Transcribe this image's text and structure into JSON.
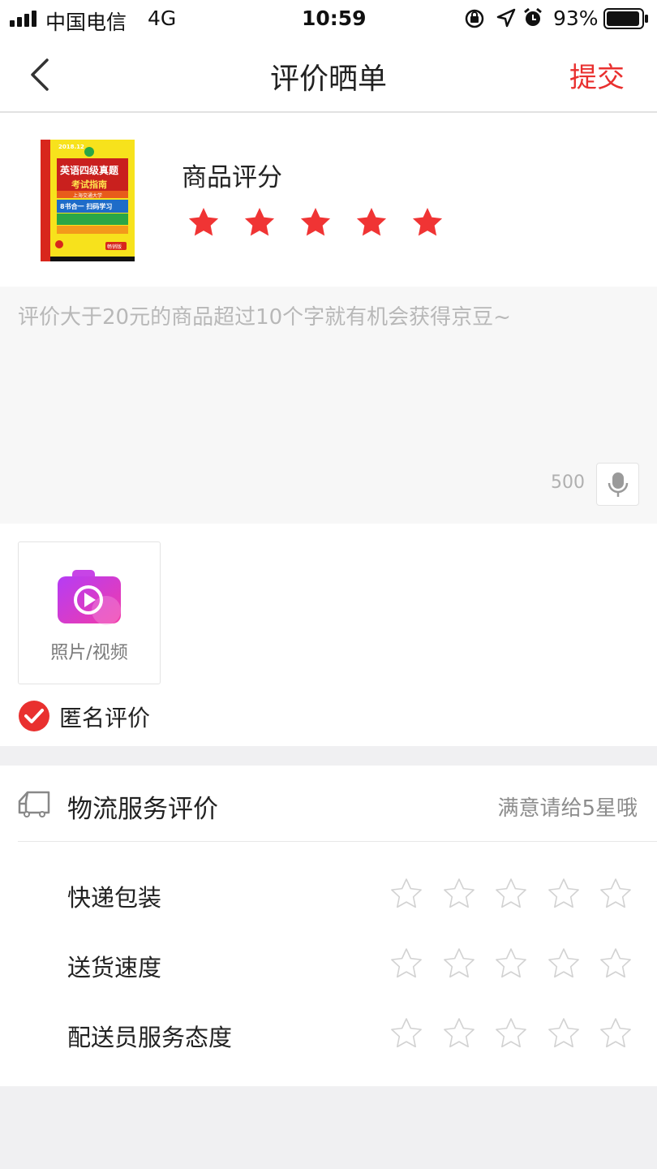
{
  "status_bar": {
    "carrier": "中国电信",
    "network": "4G",
    "time": "10:59",
    "battery": "93%",
    "icons": [
      "signal-icon",
      "orientation-lock-icon",
      "location-icon",
      "alarm-icon",
      "battery-icon"
    ]
  },
  "nav": {
    "title": "评价晒单",
    "submit_label": "提交",
    "back_icon": "chevron-left-icon"
  },
  "product": {
    "image_alt": "book-cover",
    "book_cover_lines": [
      "2018.12",
      "英语四级真题",
      "考试指南",
      "上海交通大学",
      "8书合一 扫码学习",
      "畅销版"
    ],
    "rating_label": "商品评分",
    "rating": 5,
    "rating_max": 5
  },
  "review": {
    "placeholder": "评价大于20元的商品超过10个字就有机会获得京豆~",
    "char_count": "500",
    "voice_icon": "microphone-icon"
  },
  "media": {
    "upload_label": "照片/视频",
    "upload_icon": "camera-video-icon"
  },
  "anonymous": {
    "label": "匿名评价",
    "checked": true
  },
  "logistics": {
    "title": "物流服务评价",
    "hint": "满意请给5星哦",
    "icon": "truck-icon",
    "rows": [
      {
        "label": "快递包装",
        "rating": 0
      },
      {
        "label": "送货速度",
        "rating": 0
      },
      {
        "label": "配送员服务态度",
        "rating": 0
      }
    ]
  },
  "colors": {
    "accent": "#e9302f",
    "star_filled": "#f03434",
    "star_empty": "#d2d2d2"
  }
}
